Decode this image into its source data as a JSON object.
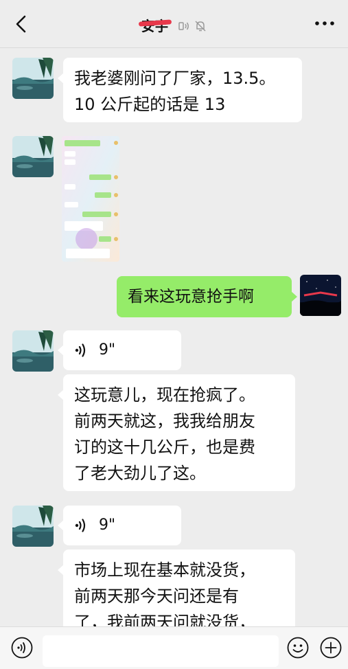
{
  "header": {
    "title": "安宇",
    "icons": [
      "back-chevron-icon",
      "voice-mode-icon",
      "mute-bell-icon",
      "more-dots-icon"
    ]
  },
  "messages": [
    {
      "type": "text",
      "side": "left",
      "lines": [
        "我老婆刚问了厂家，13.5。",
        "10 公斤起的话是 13"
      ]
    },
    {
      "type": "image",
      "side": "left"
    },
    {
      "type": "text",
      "side": "right",
      "lines": [
        "看来这玩意抢手啊"
      ]
    },
    {
      "type": "voice",
      "side": "left",
      "duration": "9\""
    },
    {
      "type": "text",
      "side": "left",
      "lines": [
        "这玩意儿，现在抢疯了。",
        "前两天就这，我我给朋友",
        "订的这十几公斤，也是费",
        "了老大劲儿了这。"
      ]
    },
    {
      "type": "voice",
      "side": "left",
      "duration": "9\""
    },
    {
      "type": "text",
      "side": "left",
      "lines": [
        "市场上现在基本就没货，",
        "前两天那今天问还是有",
        "了，我前两天问就没货，"
      ]
    }
  ],
  "input": {
    "placeholder": "",
    "value": ""
  },
  "colors": {
    "background": "#ededed",
    "bubble_left": "#ffffff",
    "bubble_right": "#95ec69"
  }
}
